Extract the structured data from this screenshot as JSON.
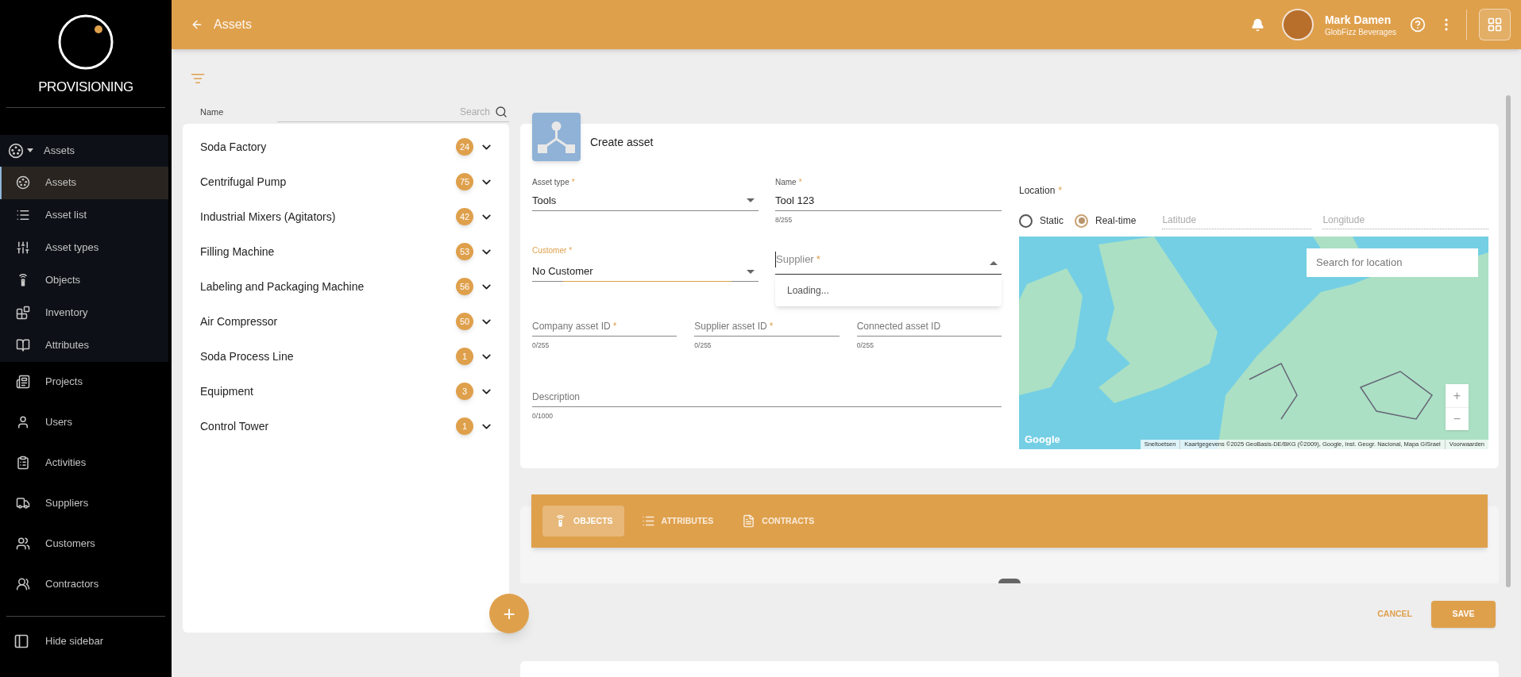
{
  "sidebar": {
    "logo_text": "PROVISIONING",
    "group": {
      "label": "Assets",
      "expanded": true,
      "items": [
        {
          "label": "Assets",
          "selected": true
        },
        {
          "label": "Asset list",
          "selected": false
        },
        {
          "label": "Asset types",
          "selected": false
        },
        {
          "label": "Objects",
          "selected": false
        },
        {
          "label": "Inventory",
          "selected": false
        },
        {
          "label": "Attributes",
          "selected": false
        }
      ]
    },
    "items": [
      {
        "label": "Projects",
        "selected": false
      },
      {
        "label": "Users",
        "selected": false
      },
      {
        "label": "Activities",
        "selected": false
      },
      {
        "label": "Suppliers",
        "selected": false
      },
      {
        "label": "Customers",
        "selected": false
      },
      {
        "label": "Contractors",
        "selected": false
      }
    ],
    "footer": {
      "label": "Hide sidebar"
    }
  },
  "header": {
    "title": "Assets",
    "user": {
      "name": "Mark Damen",
      "company": "GlobFizz Beverages"
    }
  },
  "asset_list": {
    "column": "Name",
    "search_placeholder": "Search",
    "rows": [
      {
        "label": "Soda Factory",
        "count": "24"
      },
      {
        "label": "Centrifugal Pump",
        "count": "75"
      },
      {
        "label": "Industrial Mixers (Agitators)",
        "count": "42"
      },
      {
        "label": "Filling Machine",
        "count": "53"
      },
      {
        "label": "Labeling and Packaging Machine",
        "count": "56"
      },
      {
        "label": "Air Compressor",
        "count": "50"
      },
      {
        "label": "Soda Process Line",
        "count": "1"
      },
      {
        "label": "Equipment",
        "count": "3"
      },
      {
        "label": "Control Tower",
        "count": "1"
      }
    ],
    "add_button": "+"
  },
  "form": {
    "title": "Create asset",
    "asset_type": {
      "label": "Asset type",
      "mark": "*",
      "value": "Tools"
    },
    "name": {
      "label": "Name",
      "mark": "*",
      "value": "Tool 123",
      "counter": "8/255"
    },
    "customer": {
      "label": "Customer",
      "mark": "*",
      "value": "No Customer",
      "focused": true
    },
    "supplier": {
      "label": "Supplier",
      "mark": "*",
      "expanded": true,
      "dropdown_text": "Loading..."
    },
    "ids": [
      {
        "label": "Company asset ID",
        "mark": "*",
        "counter": "0/255"
      },
      {
        "label": "Supplier asset ID",
        "mark": "*",
        "counter": "0/255"
      },
      {
        "label": "Connected asset ID",
        "counter": "0/255"
      }
    ],
    "description": {
      "label": "Description",
      "counter": "0/1000"
    },
    "location": {
      "label": "Location",
      "mark": "*",
      "modes": [
        {
          "label": "Static",
          "selected": false
        },
        {
          "label": "Real-time",
          "selected": true
        }
      ],
      "latitude_placeholder": "Latitude",
      "longitude_placeholder": "Longitude",
      "map": {
        "search_placeholder": "Search for location",
        "zoom_in": "+",
        "zoom_out": "−",
        "logo": "Google",
        "attribution": [
          "Sneltoetsen",
          "Kaartgegevens ©2025 GeoBasis-DE/BKG (©2009), Google, Inst. Geogr. Nacional, Mapa GISrael",
          "Voorwaarden"
        ]
      }
    }
  },
  "tabs": [
    {
      "label": "OBJECTS",
      "selected": true
    },
    {
      "label": "ATTRIBUTES",
      "selected": false
    },
    {
      "label": "CONTRACTS",
      "selected": false
    }
  ],
  "actions": {
    "cancel": "CANCEL",
    "save": "SAVE"
  }
}
